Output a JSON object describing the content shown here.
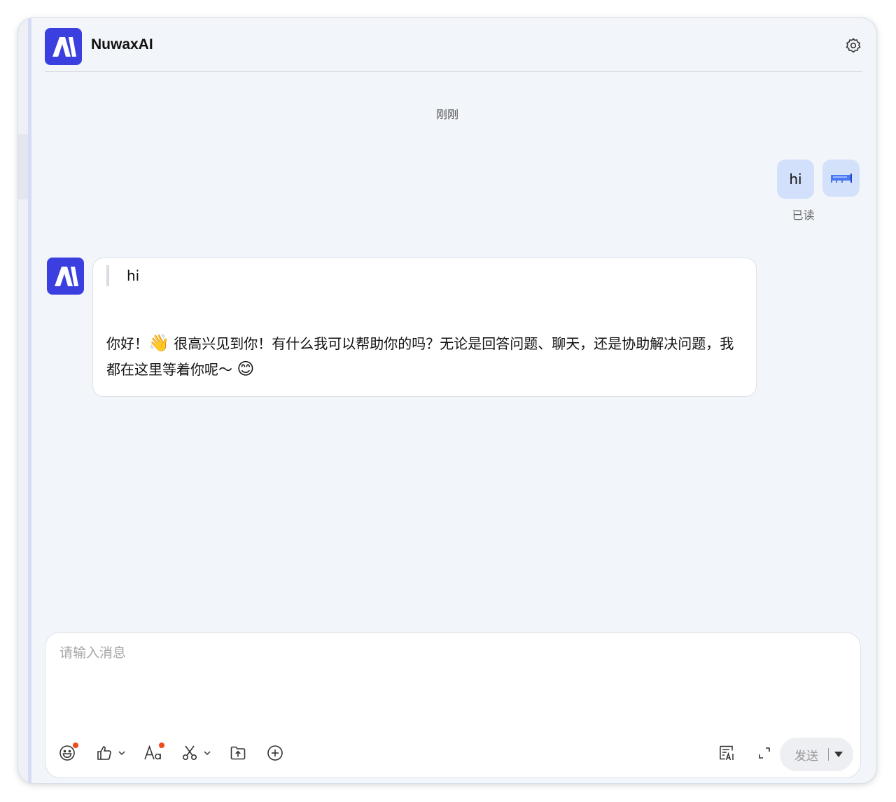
{
  "app": {
    "title": "NuwaxAI",
    "logo_text": "A\\"
  },
  "chat": {
    "timestamp": "刚刚",
    "user_message": "hi",
    "read_status": "已读",
    "bot_quote": "hi",
    "bot_reply_part1": "你好！",
    "bot_reply_emoji1": "👋",
    "bot_reply_part2": " 很高兴见到你！有什么我可以帮助你的吗？无论是回答问题、聊天，还是协助解决问题，我都在这里等着你呢～ ",
    "bot_reply_emoji2": "😊"
  },
  "composer": {
    "placeholder": "请输入消息",
    "send_label": "发送"
  },
  "colors": {
    "brand": "#3b3fe0",
    "user_bubble": "#d3e0fc",
    "notification_dot": "#f04a1d"
  },
  "icons": [
    "gear-icon",
    "emoji-icon",
    "thumbs-up-icon",
    "font-icon",
    "scissors-icon",
    "upload-folder-icon",
    "plus-circle-icon",
    "ai-summary-icon",
    "expand-icon",
    "caret-down-icon"
  ]
}
